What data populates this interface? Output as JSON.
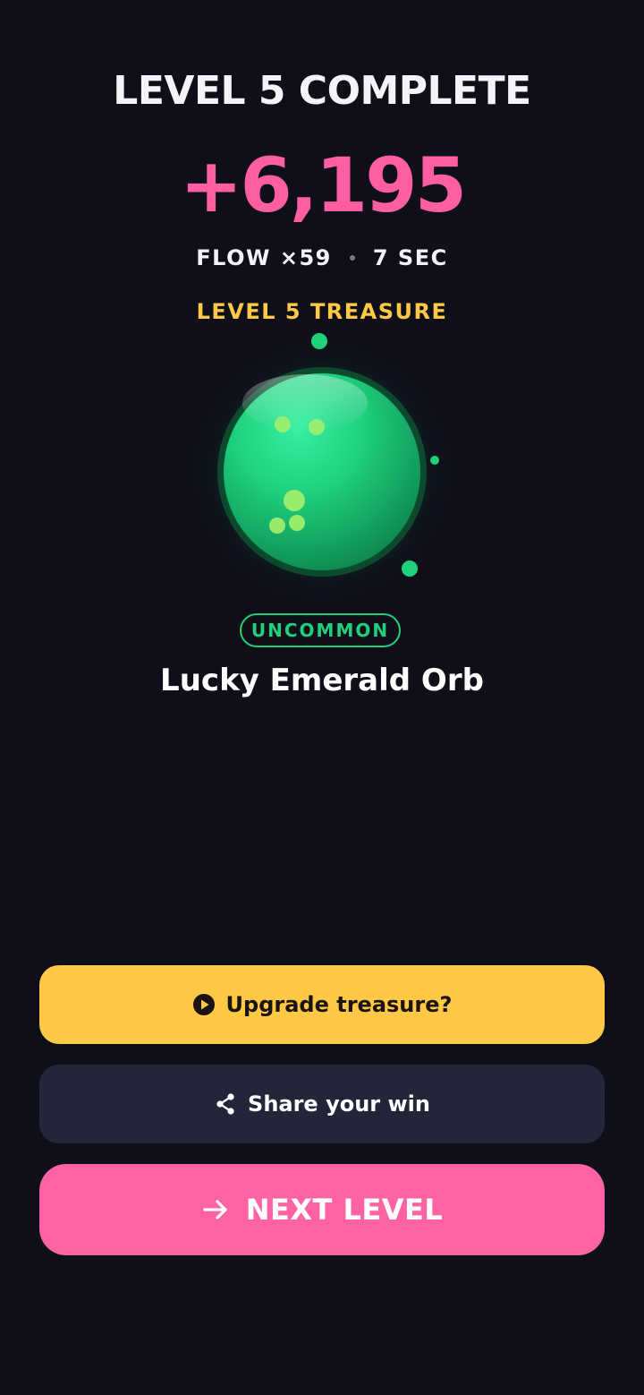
{
  "header": {
    "title": "LEVEL 5 COMPLETE",
    "score": "+6,195",
    "stats": {
      "flow": "FLOW ×59",
      "time": "7 SEC"
    }
  },
  "treasure": {
    "label": "LEVEL 5 TREASURE",
    "icon": "emerald-orb",
    "rarity": "UNCOMMON",
    "name": "Lucky Emerald Orb"
  },
  "actions": {
    "upgrade": {
      "label": "Upgrade treasure?",
      "icon": "play-circle-icon"
    },
    "share": {
      "label": "Share your win",
      "icon": "share-icon"
    },
    "next": {
      "label": "NEXT LEVEL",
      "icon": "arrow-right-icon"
    }
  },
  "colors": {
    "background": "#0f0f1a",
    "score": "#ff5fa2",
    "treasure_label": "#ffc845",
    "rarity": "#22d07c",
    "upgrade_button": "#ffc845",
    "share_button": "#232539",
    "next_button": "#ff63a3"
  }
}
